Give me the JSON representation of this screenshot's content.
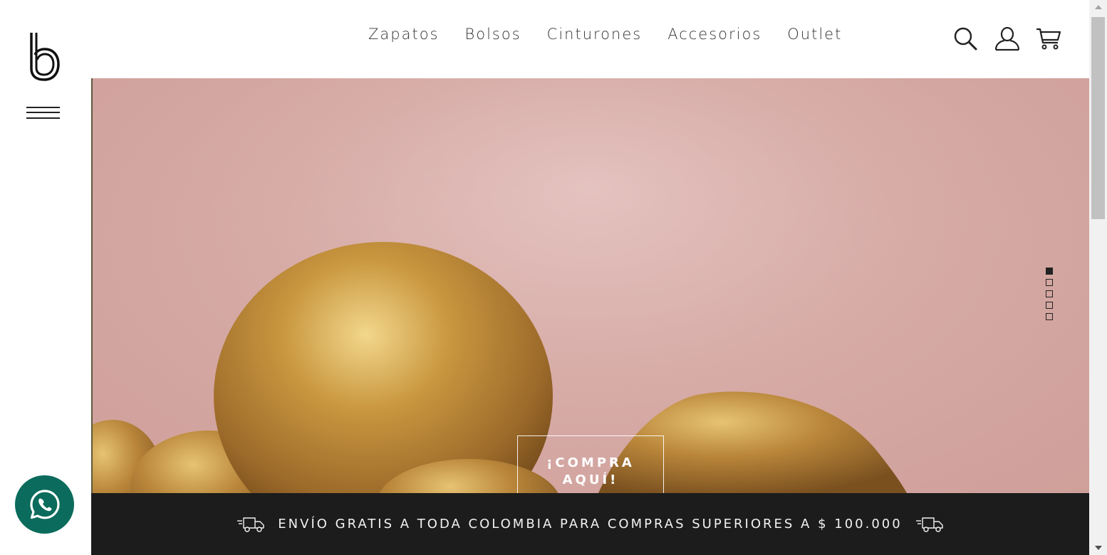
{
  "brand": {
    "logo_icon": "b-logo-icon"
  },
  "nav": {
    "items": [
      {
        "label": "Zapatos"
      },
      {
        "label": "Bolsos"
      },
      {
        "label": "Cinturones"
      },
      {
        "label": "Accesorios"
      },
      {
        "label": "Outlet"
      }
    ]
  },
  "header_icons": [
    "search-icon",
    "user-icon",
    "cart-icon"
  ],
  "hero": {
    "cta_label": "¡COMPRA AQUÍ!",
    "slides_total": 5,
    "active_slide": 1,
    "colors": {
      "background": "#d6aaa5",
      "gold": "#c9973f"
    }
  },
  "shipping_bar": {
    "text": "ENVÍO GRATIS A TODA COLOMBIA PARA COMPRAS SUPERIORES A $ 100.000",
    "background": "#1c1c1c"
  },
  "whatsapp": {
    "icon": "whatsapp-icon",
    "color": "#0b6b5c"
  }
}
